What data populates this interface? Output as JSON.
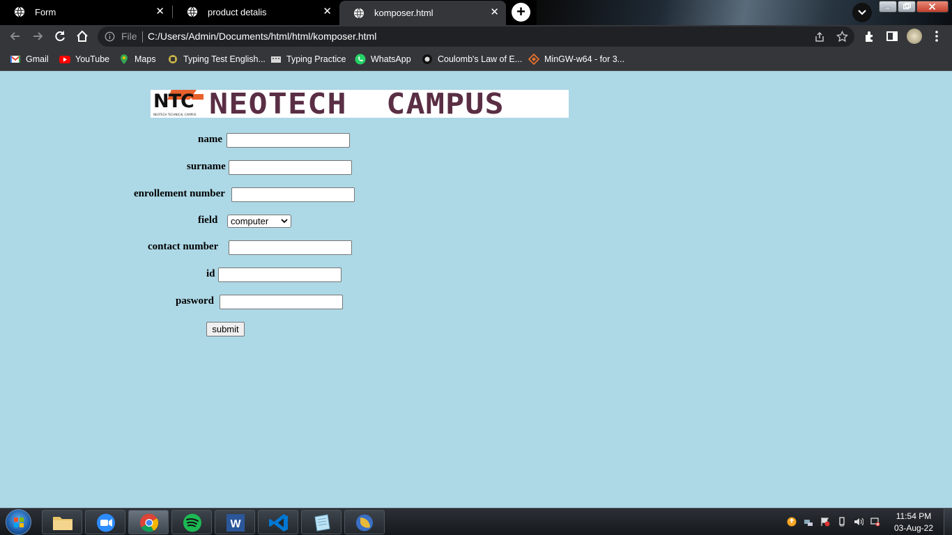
{
  "browser": {
    "tabs": [
      {
        "title": "Form"
      },
      {
        "title": "product detalis"
      },
      {
        "title": "komposer.html"
      }
    ],
    "address": {
      "scheme_label": "File",
      "url": "C:/Users/Admin/Documents/html/html/komposer.html"
    },
    "bookmarks": [
      {
        "label": "Gmail",
        "icon": "gmail-icon"
      },
      {
        "label": "YouTube",
        "icon": "youtube-icon"
      },
      {
        "label": "Maps",
        "icon": "maps-icon"
      },
      {
        "label": "Typing Test English...",
        "icon": "typing-test-icon"
      },
      {
        "label": "Typing Practice",
        "icon": "typing-practice-icon"
      },
      {
        "label": "WhatsApp",
        "icon": "whatsapp-icon"
      },
      {
        "label": "Coulomb's Law of E...",
        "icon": "coulomb-icon"
      },
      {
        "label": "MinGW-w64 - for 3...",
        "icon": "mingw-icon"
      }
    ]
  },
  "page": {
    "logo": {
      "mark": "NTC",
      "subtitle": "NEOTECH TECHNICAL CAMPUS",
      "name": "NEOTECH  CAMPUS"
    },
    "form": {
      "name_label": "name",
      "surname_label": "surname",
      "enrollment_label": "enrollement number",
      "field_label": "field",
      "field_selected": "computer",
      "contact_label": "contact number",
      "id_label": "id",
      "password_label": "pasword",
      "submit_label": "submit"
    }
  },
  "taskbar": {
    "apps": [
      "file-explorer",
      "zoom",
      "chrome",
      "spotify",
      "word",
      "vscode",
      "notepad",
      "thunderbird"
    ],
    "clock": {
      "time": "11:54 PM",
      "date": "03-Aug-22"
    }
  },
  "colors": {
    "page_background": "#add8e6",
    "logo_text": "#5a2e44",
    "logo_accent": "#e8612c"
  }
}
